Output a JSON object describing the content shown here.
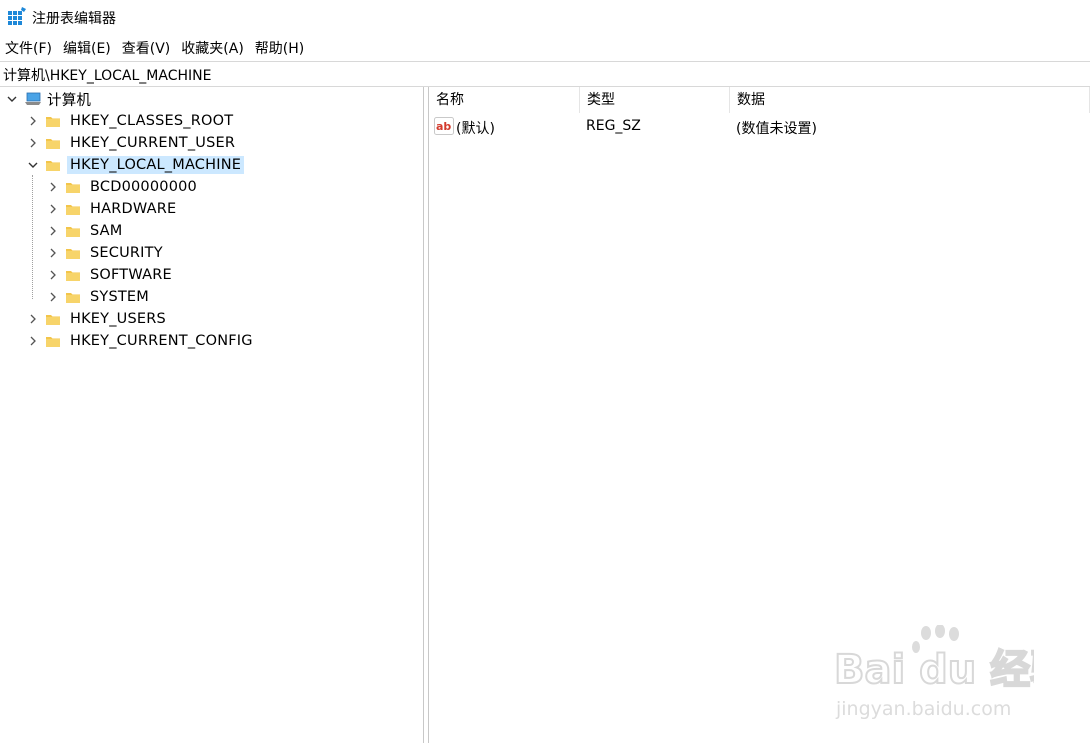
{
  "window": {
    "title": "注册表编辑器",
    "icon": "registry-icon"
  },
  "menu": [
    {
      "label": "文件(F)"
    },
    {
      "label": "编辑(E)"
    },
    {
      "label": "查看(V)"
    },
    {
      "label": "收藏夹(A)"
    },
    {
      "label": "帮助(H)"
    }
  ],
  "address": {
    "path": "计算机\\HKEY_LOCAL_MACHINE"
  },
  "tree": {
    "root": {
      "label": "计算机",
      "expanded": true,
      "icon": "computer-icon"
    },
    "hives": [
      {
        "label": "HKEY_CLASSES_ROOT",
        "expanded": false
      },
      {
        "label": "HKEY_CURRENT_USER",
        "expanded": false
      },
      {
        "label": "HKEY_LOCAL_MACHINE",
        "expanded": true,
        "selected": true
      },
      {
        "label": "HKEY_USERS",
        "expanded": false
      },
      {
        "label": "HKEY_CURRENT_CONFIG",
        "expanded": false
      }
    ],
    "hklm_children": [
      {
        "label": "BCD00000000"
      },
      {
        "label": "HARDWARE"
      },
      {
        "label": "SAM"
      },
      {
        "label": "SECURITY"
      },
      {
        "label": "SOFTWARE"
      },
      {
        "label": "SYSTEM"
      }
    ]
  },
  "list": {
    "columns": [
      {
        "label": "名称"
      },
      {
        "label": "类型"
      },
      {
        "label": "数据"
      }
    ],
    "rows": [
      {
        "name": "(默认)",
        "type": "REG_SZ",
        "data": "(数值未设置)",
        "icon": "string-value-icon",
        "icon_text": "ab"
      }
    ]
  },
  "watermark": {
    "brand": "Bai du 经验",
    "url": "jingyan.baidu.com"
  },
  "colors": {
    "selection": "#cce8ff",
    "folder": "#f3c54a",
    "icon_red": "#d33a2c"
  }
}
